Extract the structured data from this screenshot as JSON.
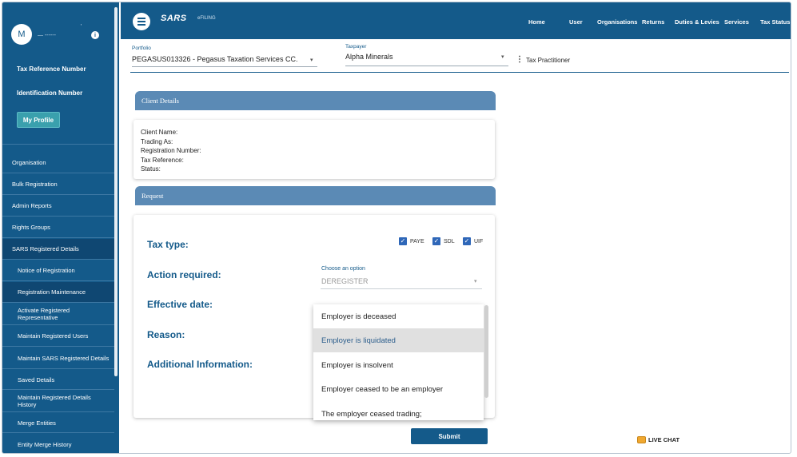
{
  "sidebar": {
    "avatar_initial": "M",
    "username": "— ------",
    "dot_mark": "'",
    "info_icon": "i",
    "tax_reference_label": "Tax Reference Number",
    "identification_label": "Identification Number",
    "profile_button": "My Profile",
    "items": [
      {
        "label": "Organisation"
      },
      {
        "label": "Bulk Registration"
      },
      {
        "label": "Admin Reports"
      },
      {
        "label": "Rights Groups"
      },
      {
        "label": "SARS Registered Details"
      },
      {
        "label": "Notice of Registration"
      },
      {
        "label": "Registration Maintenance"
      },
      {
        "label": "Activate Registered Representative"
      },
      {
        "label": "Maintain Registered Users"
      },
      {
        "label": "Maintain SARS Registered Details"
      },
      {
        "label": "Saved Details"
      },
      {
        "label": "Maintain Registered Details History"
      },
      {
        "label": "Merge Entities"
      },
      {
        "label": "Entity Merge History"
      }
    ]
  },
  "topbar": {
    "logo": "SARS",
    "efiling": "eFILING",
    "nav": [
      "Home",
      "User",
      "Organisations",
      "Returns",
      "Duties & Levies",
      "Services",
      "Tax Status"
    ]
  },
  "portfolio": {
    "label": "Portfolio",
    "value": "PEGASUS013326 - Pegasus Taxation Services CC."
  },
  "taxpayer": {
    "label": "Taxpayer",
    "value": "Alpha Minerals",
    "role": "Tax Practitioner"
  },
  "client_details": {
    "title": "Client Details",
    "fields": [
      "Client Name:",
      "Trading As:",
      "Registration Number:",
      "Tax Reference:",
      "Status:"
    ]
  },
  "request": {
    "title": "Request",
    "tax_type_label": "Tax type:",
    "tax_types": [
      {
        "label": "PAYE",
        "checked": true
      },
      {
        "label": "SDL",
        "checked": true
      },
      {
        "label": "UIF",
        "checked": true
      }
    ],
    "action_label": "Action required:",
    "action_select_label": "Choose an option",
    "action_value": "DEREGISTER",
    "effective_date_label": "Effective date:",
    "reason_label": "Reason:",
    "additional_label": "Additional Information:",
    "reason_options": [
      "Employer is deceased",
      "Employer is liquidated",
      "Employer is insolvent",
      "Employer ceased to be an employer",
      "The employer ceased trading;"
    ],
    "highlighted_option": "Employer is liquidated",
    "submit_label": "Submit"
  },
  "livechat": {
    "label": "LIVE CHAT"
  }
}
